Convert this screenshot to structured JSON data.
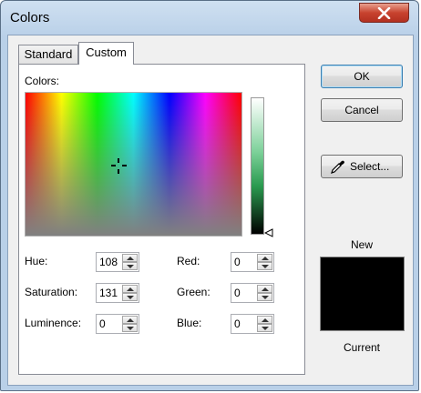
{
  "window": {
    "title": "Colors",
    "close_label": "close-icon"
  },
  "tabs": [
    {
      "label": "Standard"
    },
    {
      "label": "Custom"
    }
  ],
  "custom": {
    "colors_label": "Colors:",
    "fields": {
      "hue": {
        "label": "Hue:",
        "value": "108"
      },
      "saturation": {
        "label": "Saturation:",
        "value": "131"
      },
      "luminence": {
        "label": "Luminence:",
        "value": "0"
      },
      "red": {
        "label": "Red:",
        "value": "0"
      },
      "green": {
        "label": "Green:",
        "value": "0"
      },
      "blue": {
        "label": "Blue:",
        "value": "0"
      }
    }
  },
  "buttons": {
    "ok": "OK",
    "cancel": "Cancel",
    "select": "Select..."
  },
  "preview": {
    "new_label": "New",
    "current_label": "Current",
    "color": "#000000"
  },
  "colors": {
    "accent": "#3c7fb1",
    "title_bar": "#b9d0e8",
    "close_button": "#c8432f"
  }
}
